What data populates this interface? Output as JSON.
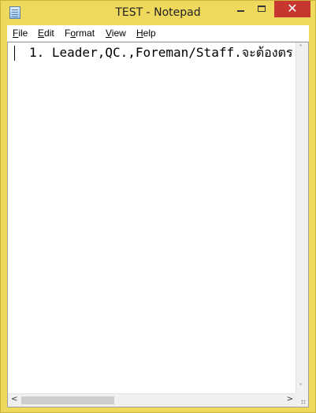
{
  "window": {
    "title": "TEST - Notepad",
    "close_glyph": "✕",
    "icons": {
      "app": "notepad-icon",
      "minimize": "minimize-icon",
      "maximize": "maximize-icon",
      "close": "close-icon"
    }
  },
  "menu": [
    {
      "accel": "F",
      "rest": "ile"
    },
    {
      "accel": "E",
      "rest": "dit"
    },
    {
      "pre": "F",
      "accel": "o",
      "rest": "rmat"
    },
    {
      "accel": "V",
      "rest": "iew"
    },
    {
      "accel": "H",
      "rest": "elp"
    }
  ],
  "editor": {
    "text": "1. Leader,QC.,Foreman/Staff.จะต้องตร"
  },
  "scrollbars": {
    "up": "˄",
    "down": "˅",
    "left": "<",
    "right": ">"
  },
  "colors": {
    "frame": "#efd95c",
    "close_button": "#c7372f"
  }
}
